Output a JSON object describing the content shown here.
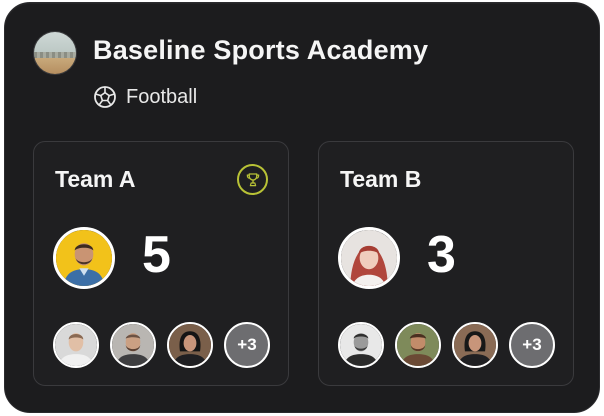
{
  "academy": {
    "name": "Baseline Sports Academy",
    "avatar_icon": "academy-photo",
    "sport": "Football",
    "sport_icon": "soccer-ball-icon"
  },
  "teams": [
    {
      "name": "Team A",
      "score": "5",
      "winner": true,
      "winner_icon": "trophy-icon",
      "winner_color": "#b8c236",
      "captain_avatar": "person-photo",
      "members_more": "+3"
    },
    {
      "name": "Team B",
      "score": "3",
      "winner": false,
      "captain_avatar": "person-photo",
      "members_more": "+3"
    }
  ],
  "colors": {
    "background": "#1c1c1e",
    "panel_border": "#3a3a3d",
    "text": "#f5f5f5",
    "accent": "#b8c236"
  }
}
